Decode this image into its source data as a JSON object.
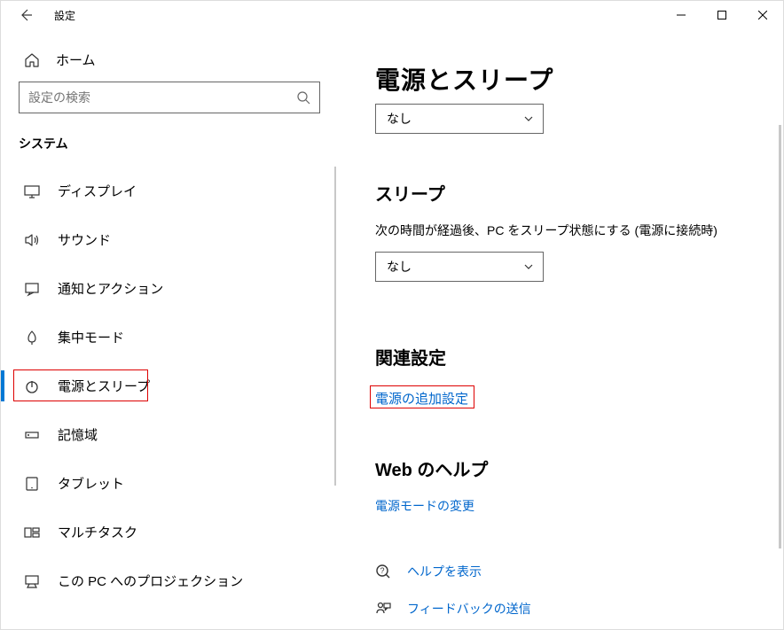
{
  "titlebar": {
    "title": "設定"
  },
  "sidebar": {
    "home_label": "ホーム",
    "search_placeholder": "設定の検索",
    "category_label": "システム",
    "items": [
      {
        "label": "ディスプレイ"
      },
      {
        "label": "サウンド"
      },
      {
        "label": "通知とアクション"
      },
      {
        "label": "集中モード"
      },
      {
        "label": "電源とスリープ"
      },
      {
        "label": "記憶域"
      },
      {
        "label": "タブレット"
      },
      {
        "label": "マルチタスク"
      },
      {
        "label": "この PC へのプロジェクション"
      }
    ]
  },
  "main": {
    "page_title": "電源とスリープ",
    "screen_select_value": "なし",
    "sleep_title": "スリープ",
    "sleep_desc": "次の時間が経過後、PC をスリープ状態にする (電源に接続時)",
    "sleep_select_value": "なし",
    "related_title": "関連設定",
    "related_link": "電源の追加設定",
    "webhelp_title": "Web のヘルプ",
    "webhelp_link": "電源モードの変更",
    "help_link": "ヘルプを表示",
    "feedback_link": "フィードバックの送信"
  }
}
